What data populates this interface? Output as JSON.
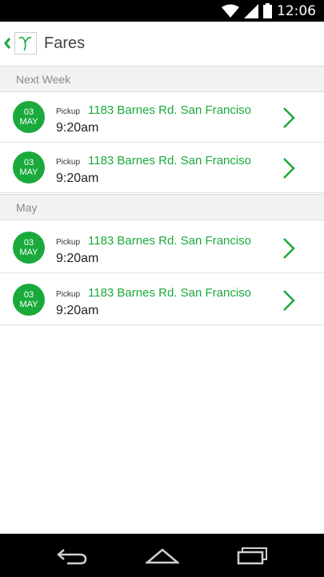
{
  "status_bar": {
    "time": "12:06"
  },
  "app_bar": {
    "title": "Fares"
  },
  "sections": [
    {
      "header": "Next Week",
      "rows": [
        {
          "day": "03",
          "month": "MAY",
          "pickup_label": "Pickup",
          "address": "1183 Barnes Rd. San Franciso",
          "time": "9:20am"
        },
        {
          "day": "03",
          "month": "MAY",
          "pickup_label": "Pickup",
          "address": "1183 Barnes Rd. San Franciso",
          "time": "9:20am"
        }
      ]
    },
    {
      "header": "May",
      "rows": [
        {
          "day": "03",
          "month": "MAY",
          "pickup_label": "Pickup",
          "address": "1183 Barnes Rd. San Franciso",
          "time": "9:20am"
        },
        {
          "day": "03",
          "month": "MAY",
          "pickup_label": "Pickup",
          "address": "1183 Barnes Rd. San Franciso",
          "time": "9:20am"
        }
      ]
    }
  ],
  "colors": {
    "accent": "#1aaa3c",
    "section_bg": "#f2f2f2"
  },
  "icons": [
    "wifi-icon",
    "signal-icon",
    "battery-icon",
    "back-chevron-icon",
    "app-logo",
    "chevron-right-icon",
    "back-nav-icon",
    "home-nav-icon",
    "recents-nav-icon"
  ]
}
